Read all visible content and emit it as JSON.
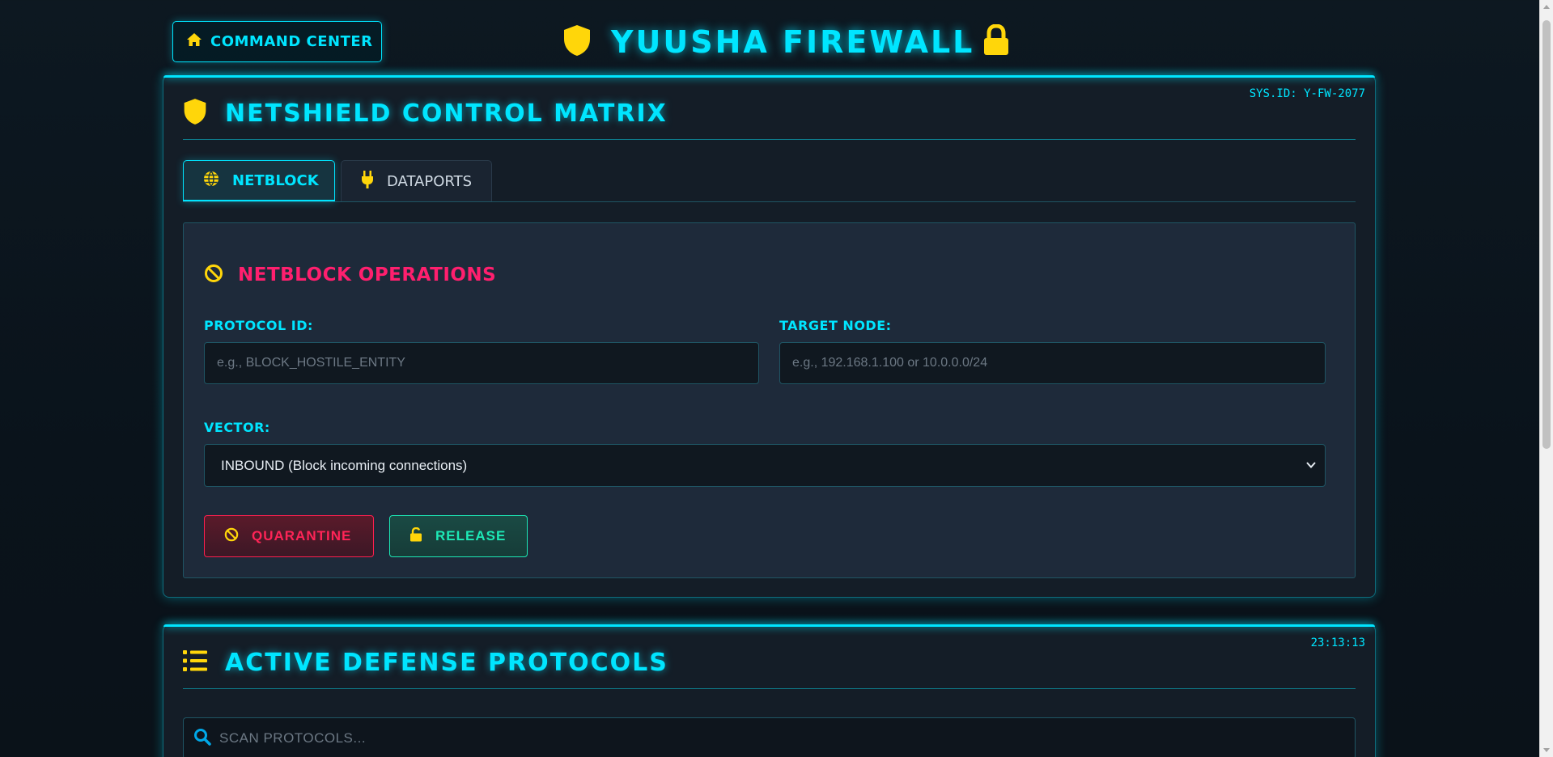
{
  "header": {
    "home_label": "COMMAND CENTER",
    "app_title": "YUUSHA FIREWALL"
  },
  "panel1": {
    "sys_id": "SYS.ID: Y-FW-2077",
    "title": "NETSHIELD CONTROL MATRIX",
    "tabs": [
      {
        "label": "NETBLOCK",
        "icon": "globe-icon",
        "active": true
      },
      {
        "label": "DATAPORTS",
        "icon": "plug-icon",
        "active": false
      }
    ],
    "section_title": "NETBLOCK OPERATIONS",
    "protocol_label": "PROTOCOL ID:",
    "protocol_placeholder": "e.g., BLOCK_HOSTILE_ENTITY",
    "target_label": "TARGET NODE:",
    "target_placeholder": "e.g., 192.168.1.100 or 10.0.0.0/24",
    "vector_label": "VECTOR:",
    "vector_selected": "INBOUND (Block incoming connections)",
    "quarantine_label": "QUARANTINE",
    "release_label": "RELEASE"
  },
  "panel2": {
    "clock": "23:13:13",
    "title": "ACTIVE DEFENSE PROTOCOLS",
    "search_placeholder": "SCAN PROTOCOLS..."
  },
  "colors": {
    "accent": "#00e5ff",
    "icon_yellow": "#ffd60a",
    "danger": "#ff2457",
    "success": "#1de9b6",
    "background": "#0d1821",
    "panel": "#141d27"
  }
}
